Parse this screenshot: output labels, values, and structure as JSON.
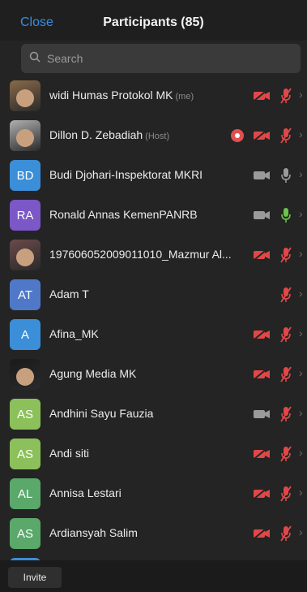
{
  "header": {
    "close_label": "Close",
    "title": "Participants (85)"
  },
  "search": {
    "placeholder": "Search"
  },
  "participants": [
    {
      "name": "widi Humas Protokol MK",
      "tag": "(me)",
      "avatar_type": "photo",
      "avatar_initials": "",
      "avatar_color": "#8a6a4a",
      "video": "off",
      "audio": "muted",
      "recording": false
    },
    {
      "name": "Dillon D. Zebadiah",
      "tag": "(Host)",
      "avatar_type": "photo",
      "avatar_initials": "",
      "avatar_color": "#b0b0b0",
      "video": "off",
      "audio": "muted",
      "recording": true
    },
    {
      "name": "Budi Djohari-Inspektorat MKRI",
      "tag": "",
      "avatar_type": "initials",
      "avatar_initials": "BD",
      "avatar_color": "#3b8ed8",
      "video": "on",
      "audio": "unmuted",
      "recording": false
    },
    {
      "name": "Ronald Annas KemenPANRB",
      "tag": "",
      "avatar_type": "initials",
      "avatar_initials": "RA",
      "avatar_color": "#7b57c8",
      "video": "on",
      "audio": "speaking",
      "recording": false
    },
    {
      "name": "197606052009011010_Mazmur Al...",
      "tag": "",
      "avatar_type": "photo",
      "avatar_initials": "",
      "avatar_color": "#6a4a4a",
      "video": "off",
      "audio": "muted",
      "recording": false
    },
    {
      "name": "Adam T",
      "tag": "",
      "avatar_type": "initials",
      "avatar_initials": "AT",
      "avatar_color": "#4f78c8",
      "video": "none",
      "audio": "muted",
      "recording": false
    },
    {
      "name": "Afina_MK",
      "tag": "",
      "avatar_type": "initials",
      "avatar_initials": "A",
      "avatar_color": "#3b8ed8",
      "video": "off",
      "audio": "muted",
      "recording": false
    },
    {
      "name": "Agung Media MK",
      "tag": "",
      "avatar_type": "photo",
      "avatar_initials": "",
      "avatar_color": "#1a1a1a",
      "video": "off",
      "audio": "muted",
      "recording": false
    },
    {
      "name": "Andhini Sayu Fauzia",
      "tag": "",
      "avatar_type": "initials",
      "avatar_initials": "AS",
      "avatar_color": "#8cc05a",
      "video": "on",
      "audio": "muted",
      "recording": false
    },
    {
      "name": "Andi siti",
      "tag": "",
      "avatar_type": "initials",
      "avatar_initials": "AS",
      "avatar_color": "#8cc05a",
      "video": "off",
      "audio": "muted",
      "recording": false
    },
    {
      "name": "Annisa Lestari",
      "tag": "",
      "avatar_type": "initials",
      "avatar_initials": "AL",
      "avatar_color": "#5aa86a",
      "video": "off",
      "audio": "muted",
      "recording": false
    },
    {
      "name": "Ardiansyah Salim",
      "tag": "",
      "avatar_type": "initials",
      "avatar_initials": "AS",
      "avatar_color": "#5aa86a",
      "video": "off",
      "audio": "muted",
      "recording": false
    },
    {
      "name": "",
      "tag": "",
      "avatar_type": "initials",
      "avatar_initials": "",
      "avatar_color": "#3b8ed8",
      "video": "off",
      "audio": "muted",
      "recording": false
    }
  ],
  "footer": {
    "invite_label": "Invite"
  },
  "colors": {
    "accent": "#3a8ee6",
    "muted_red": "#e04848",
    "speaking_green": "#6cc24a",
    "icon_gray": "#9a9a9a"
  }
}
